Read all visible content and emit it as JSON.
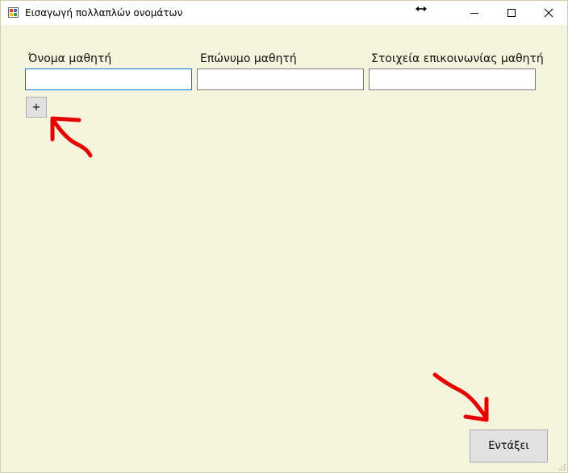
{
  "window": {
    "title": "Εισαγωγή πολλαπλών ονομάτων",
    "controls": {
      "minimize": "minimize",
      "maximize": "maximize",
      "close": "close"
    }
  },
  "form": {
    "columns": [
      {
        "label": "Όνομα μαθητή",
        "value": ""
      },
      {
        "label": "Επώνυμο μαθητή",
        "value": ""
      },
      {
        "label": "Στοιχεία επικοινωνίας μαθητή",
        "value": ""
      }
    ],
    "add_button_label": "+",
    "submit_button_label": "Εντάξει"
  },
  "colors": {
    "background": "#f5f4dc",
    "focus_border": "#0078d7",
    "annotation": "#e60000"
  },
  "icons": [
    "app-icon",
    "resize-cursor-icon",
    "minimize-icon",
    "maximize-icon",
    "close-icon",
    "size-grip-icon"
  ]
}
